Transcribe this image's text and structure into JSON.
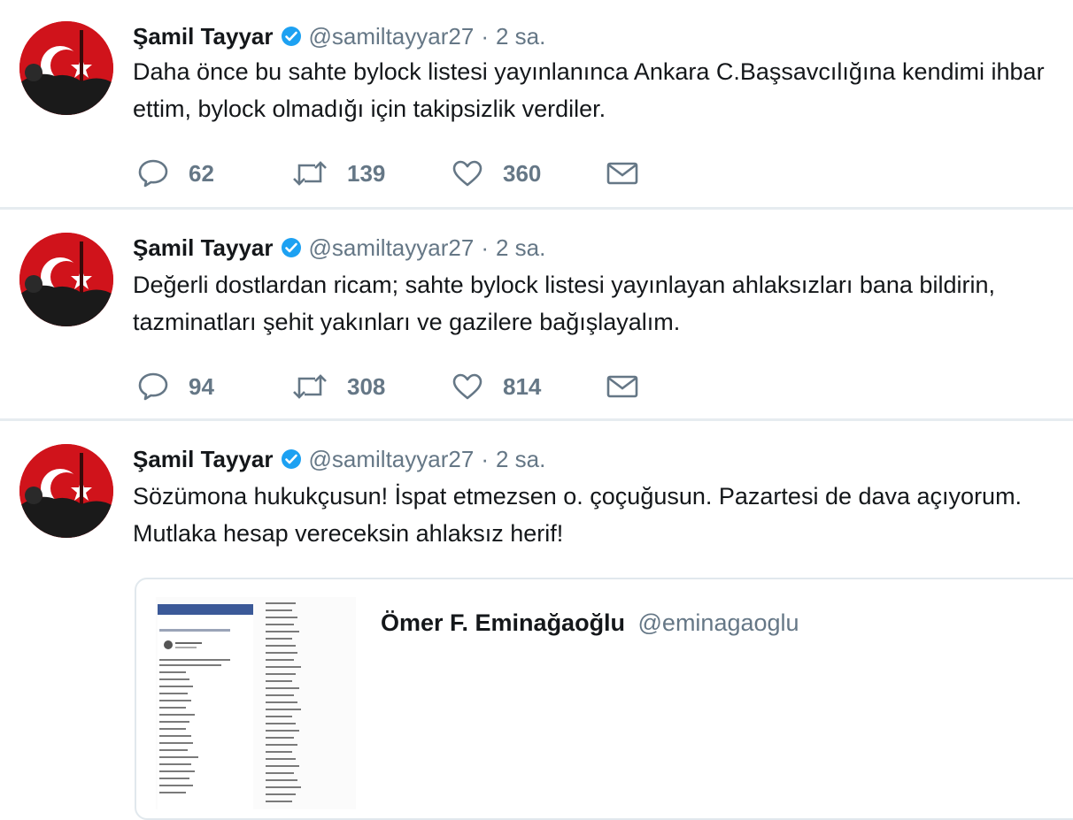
{
  "tweets": [
    {
      "author": "Şamil Tayyar",
      "handle": "@samiltayyar27",
      "separator": "·",
      "time": "2 sa.",
      "text": "Daha önce bu sahte bylock listesi yayınlanınca Ankara C.Başsavcılığına kendimi ihbar ettim, bylock olmadığı için takipsizlik verdiler.",
      "replies": "62",
      "retweets": "139",
      "likes": "360"
    },
    {
      "author": "Şamil Tayyar",
      "handle": "@samiltayyar27",
      "separator": "·",
      "time": "2 sa.",
      "text": "Değerli dostlardan ricam; sahte bylock listesi yayınlayan ahlaksızları bana bildirin, tazminatları şehit yakınları ve gazilere bağışlayalım.",
      "replies": "94",
      "retweets": "308",
      "likes": "814"
    },
    {
      "author": "Şamil Tayyar",
      "handle": "@samiltayyar27",
      "separator": "·",
      "time": "2 sa.",
      "text": "Sözümona hukukçusun! İspat etmezsen o. çoçuğusun. Pazartesi de dava açıyorum. Mutlaka hesap vereceksin ahlaksız herif!",
      "quoted": {
        "author": "Ömer F. Eminağaoğlu",
        "handle": "@eminagaoglu"
      }
    }
  ],
  "icons": {
    "reply": "reply-icon",
    "retweet": "retweet-icon",
    "like": "like-icon",
    "message": "direct-message-icon",
    "verified": "verified-badge-icon"
  },
  "colors": {
    "text": "#14171a",
    "secondary": "#657786",
    "verified": "#1da1f2",
    "divider": "#e6ecf0",
    "avatar_bg": "#d0131b"
  }
}
